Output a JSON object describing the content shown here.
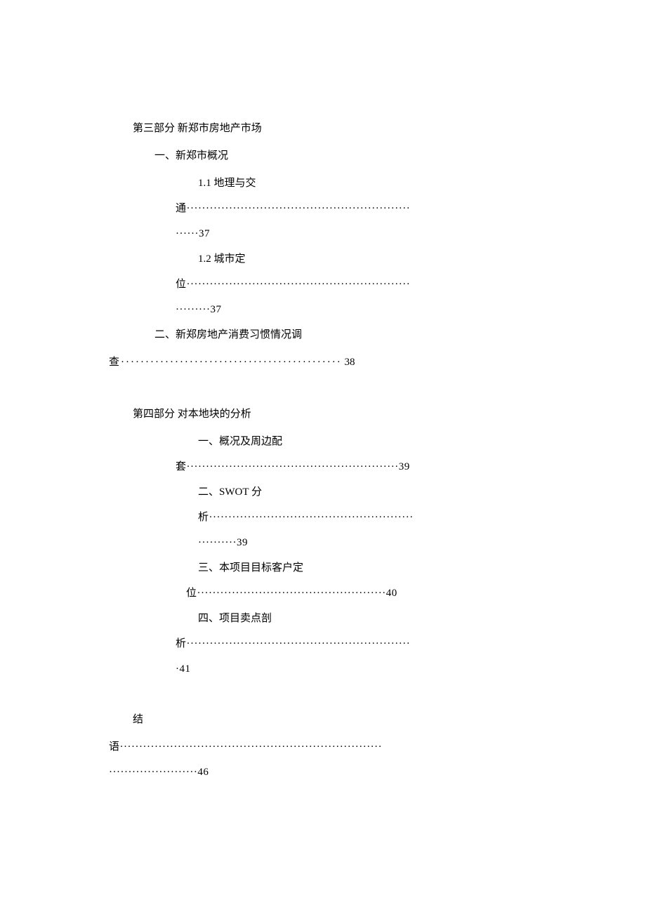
{
  "section3": {
    "title": "第三部分 新郑市房地产市场",
    "entry1": {
      "label": "一、新郑市概况"
    },
    "sub11": {
      "label": "1.1 地理与交",
      "cont": "通··························································",
      "page": "······37"
    },
    "sub12": {
      "label": "1.2 城市定",
      "cont": "位··························································",
      "page": "·········37"
    },
    "entry2": {
      "line1": "二、新郑房地产消费习惯情况调",
      "line2": "查·············································",
      "page": "38"
    }
  },
  "section4": {
    "title": "第四部分 对本地块的分析",
    "entry1": {
      "label": "一、概况及周边配",
      "cont": "套",
      "middle": "·······················································",
      "page": "39"
    },
    "entry2": {
      "label": "二、SWOT 分",
      "cont": "析·····················································",
      "page": "··········39"
    },
    "entry3": {
      "label": "三、本项目目标客户定",
      "cont": "位·················································",
      "page": "40"
    },
    "entry4": {
      "label": "四、项目卖点剖",
      "cont": "析··························································",
      "page": "·41"
    }
  },
  "conclusion": {
    "label": "结",
    "cont": "语····································································",
    "page": "·······················46"
  }
}
